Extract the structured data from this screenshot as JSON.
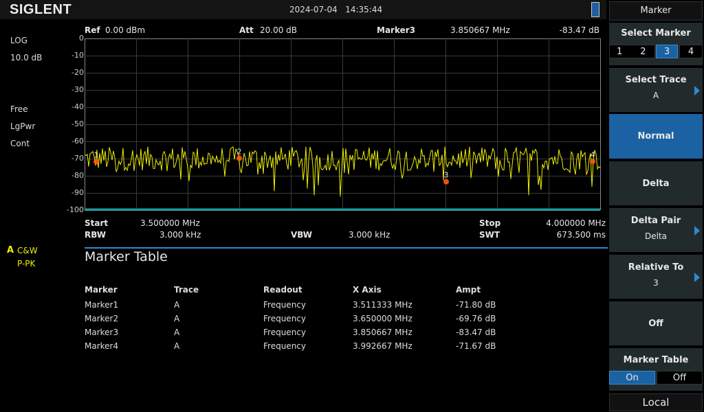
{
  "header": {
    "logo": "SIGLENT",
    "date": "2024-07-04",
    "time": "14:35:44"
  },
  "left_panel": {
    "scale_type": "LOG",
    "scale_div": "10.0 dB",
    "trig": "Free",
    "detector_mode": "LgPwr",
    "sweep": "Cont",
    "trace_label": "A",
    "trace_mode": "C&W",
    "trace_detector": "P-PK"
  },
  "top_info": {
    "ref_label": "Ref",
    "ref_value": "0.00 dBm",
    "att_label": "Att",
    "att_value": "20.00 dB",
    "marker_label": "Marker3",
    "marker_freq": "3.850667 MHz",
    "marker_ampt": "-83.47 dB"
  },
  "y_ticks": [
    "0",
    "-10",
    "-20",
    "-30",
    "-40",
    "-50",
    "-60",
    "-70",
    "-80",
    "-90",
    "-100"
  ],
  "bottom_info": {
    "start_label": "Start",
    "start": "3.500000 MHz",
    "stop_label": "Stop",
    "stop": "4.000000 MHz",
    "rbw_label": "RBW",
    "rbw": "3.000 kHz",
    "vbw_label": "VBW",
    "vbw": "3.000 kHz",
    "swt_label": "SWT",
    "swt": "673.500 ms"
  },
  "colors": {
    "trace": "#f0f000",
    "marker": "#ff5a10",
    "accent": "#1a62a3",
    "grid": "#3a3a3a"
  },
  "chart_data": {
    "type": "line",
    "x_range_mhz": [
      3.5,
      4.0
    ],
    "ylim": [
      -100,
      0
    ],
    "y_unit": "dBm",
    "grid": true,
    "markers": [
      {
        "label": "1",
        "x": 3.511333,
        "y": -71.8
      },
      {
        "label": "2",
        "x": 3.65,
        "y": -69.76
      },
      {
        "label": "3",
        "x": 3.850667,
        "y": -83.47
      },
      {
        "label": "4",
        "x": 3.992667,
        "y": -71.67
      }
    ],
    "noise_floor_approx": -70
  },
  "marker_table": {
    "title": "Marker Table",
    "headers": [
      "Marker",
      "Trace",
      "Readout",
      "X Axis",
      "Ampt"
    ],
    "rows": [
      [
        "Marker1",
        "A",
        "Frequency",
        "3.511333 MHz",
        "-71.80 dB"
      ],
      [
        "Marker2",
        "A",
        "Frequency",
        "3.650000 MHz",
        "-69.76 dB"
      ],
      [
        "Marker3",
        "A",
        "Frequency",
        "3.850667 MHz",
        "-83.47 dB"
      ],
      [
        "Marker4",
        "A",
        "Frequency",
        "3.992667 MHz",
        "-71.67 dB"
      ]
    ]
  },
  "softkeys": {
    "menu_title": "Marker",
    "select_marker": "Select Marker",
    "marker_options": [
      "1",
      "2",
      "3",
      "4"
    ],
    "selected_marker": "3",
    "select_trace": "Select Trace",
    "select_trace_value": "A",
    "normal": "Normal",
    "delta": "Delta",
    "delta_pair": "Delta Pair",
    "delta_pair_value": "Delta",
    "relative_to": "Relative To",
    "relative_to_value": "3",
    "off": "Off",
    "marker_table": "Marker Table",
    "on_label": "On",
    "off_label": "Off",
    "local": "Local"
  }
}
